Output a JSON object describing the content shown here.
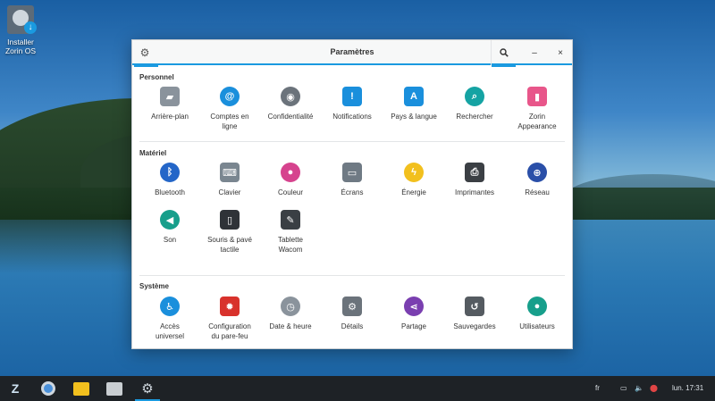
{
  "desktop": {
    "icon_label_line1": "Installer",
    "icon_label_line2": "Zorin OS"
  },
  "window": {
    "title": "Paramètres",
    "header_icon": "gear-icon",
    "search_icon": "search-icon",
    "minimize_label": "–",
    "close_label": "×"
  },
  "sections": {
    "personnel": {
      "title": "Personnel",
      "items": [
        {
          "l1": "Arrière-plan",
          "l2": "",
          "icon": "wallpaper-icon",
          "color": "#8a939c"
        },
        {
          "l1": "Comptes en",
          "l2": "ligne",
          "icon": "at-icon",
          "color": "#1a8fdc"
        },
        {
          "l1": "Confidentialité",
          "l2": "",
          "icon": "privacy-icon",
          "color": "#6b737b"
        },
        {
          "l1": "Notifications",
          "l2": "",
          "icon": "notification-icon",
          "color": "#1a8fdc"
        },
        {
          "l1": "Pays & langue",
          "l2": "",
          "icon": "language-icon",
          "color": "#1a8fdc"
        },
        {
          "l1": "Rechercher",
          "l2": "",
          "icon": "search-icon",
          "color": "#15a3a3"
        },
        {
          "l1": "Zorin",
          "l2": "Appearance",
          "icon": "appearance-icon",
          "color": "#e8568a"
        }
      ]
    },
    "materiel": {
      "title": "Matériel",
      "items": [
        {
          "l1": "Bluetooth",
          "l2": "",
          "icon": "bluetooth-icon",
          "color": "#2466c8"
        },
        {
          "l1": "Clavier",
          "l2": "",
          "icon": "keyboard-icon",
          "color": "#7a8690"
        },
        {
          "l1": "Couleur",
          "l2": "",
          "icon": "color-wheel-icon",
          "color": "#d6438e"
        },
        {
          "l1": "Écrans",
          "l2": "",
          "icon": "display-icon",
          "color": "#6f7a84"
        },
        {
          "l1": "Énergie",
          "l2": "",
          "icon": "power-icon",
          "color": "#f2c01e"
        },
        {
          "l1": "Imprimantes",
          "l2": "",
          "icon": "printer-icon",
          "color": "#3b3f44"
        },
        {
          "l1": "Réseau",
          "l2": "",
          "icon": "network-icon",
          "color": "#2a4fa8"
        },
        {
          "l1": "Son",
          "l2": "",
          "icon": "sound-icon",
          "color": "#179f8b"
        },
        {
          "l1": "Souris & pavé",
          "l2": "tactile",
          "icon": "mouse-icon",
          "color": "#2f3338"
        },
        {
          "l1": "Tablette",
          "l2": "Wacom",
          "icon": "tablet-icon",
          "color": "#3a3f44"
        }
      ]
    },
    "systeme": {
      "title": "Système",
      "items": [
        {
          "l1": "Accès",
          "l2": "universel",
          "icon": "accessibility-icon",
          "color": "#1a8fdc"
        },
        {
          "l1": "Configuration",
          "l2": "du pare-feu",
          "icon": "firewall-icon",
          "color": "#d8322c"
        },
        {
          "l1": "Date & heure",
          "l2": "",
          "icon": "clock-icon",
          "color": "#8a939c"
        },
        {
          "l1": "Détails",
          "l2": "",
          "icon": "gear-icon",
          "color": "#6b737b"
        },
        {
          "l1": "Partage",
          "l2": "",
          "icon": "share-icon",
          "color": "#7a3fb0"
        },
        {
          "l1": "Sauvegardes",
          "l2": "",
          "icon": "backup-icon",
          "color": "#555b61"
        },
        {
          "l1": "Utilisateurs",
          "l2": "",
          "icon": "user-icon",
          "color": "#179f8b"
        }
      ]
    }
  },
  "taskbar": {
    "apps": [
      "zorin-menu-icon",
      "browser-icon",
      "mail-icon",
      "files-icon",
      "settings-icon"
    ],
    "layout_indicator": "fr",
    "time": "lun. 17:31"
  }
}
